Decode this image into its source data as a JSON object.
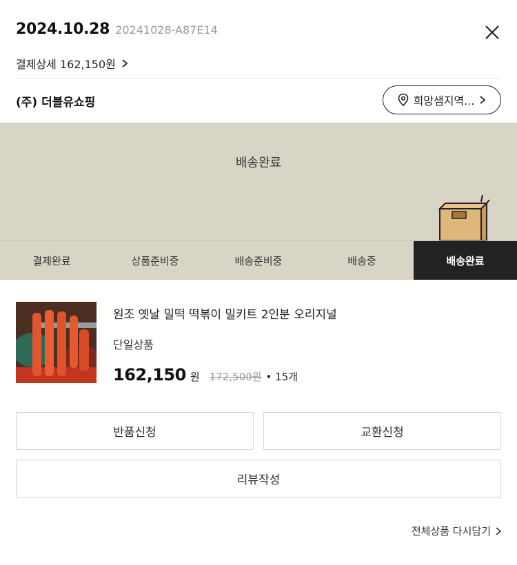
{
  "header": {
    "order_date": "2024.10.28",
    "order_number": "20241028-A87E14",
    "payment_detail_label": "결제상세 162,150원"
  },
  "seller": {
    "name": "(주) 더블유쇼핑",
    "area_button_label": "희망샘지역..."
  },
  "status": {
    "title": "배송완료"
  },
  "steps": [
    {
      "label": "결제완료",
      "active": false
    },
    {
      "label": "상품준비중",
      "active": false
    },
    {
      "label": "배송준비중",
      "active": false
    },
    {
      "label": "배송중",
      "active": false
    },
    {
      "label": "배송완료",
      "active": true
    }
  ],
  "product": {
    "name": "원조 옛날 밀떡 떡볶이 밀키트 2인분 오리지널",
    "option": "단일상품",
    "price": "162,150",
    "price_unit": "원",
    "original_price": "172,500원",
    "quantity": "• 15개"
  },
  "actions": {
    "return_label": "반품신청",
    "exchange_label": "교환신청",
    "review_label": "리뷰작성",
    "recart_label": "전체상품 다시담기"
  },
  "icons": {
    "close": "close-icon",
    "chevron": "chevron-right-icon",
    "location": "location-pin-icon",
    "box": "package-box-icon"
  },
  "colors": {
    "banner_bg": "#d8d4c6",
    "active_step_bg": "#222222"
  }
}
